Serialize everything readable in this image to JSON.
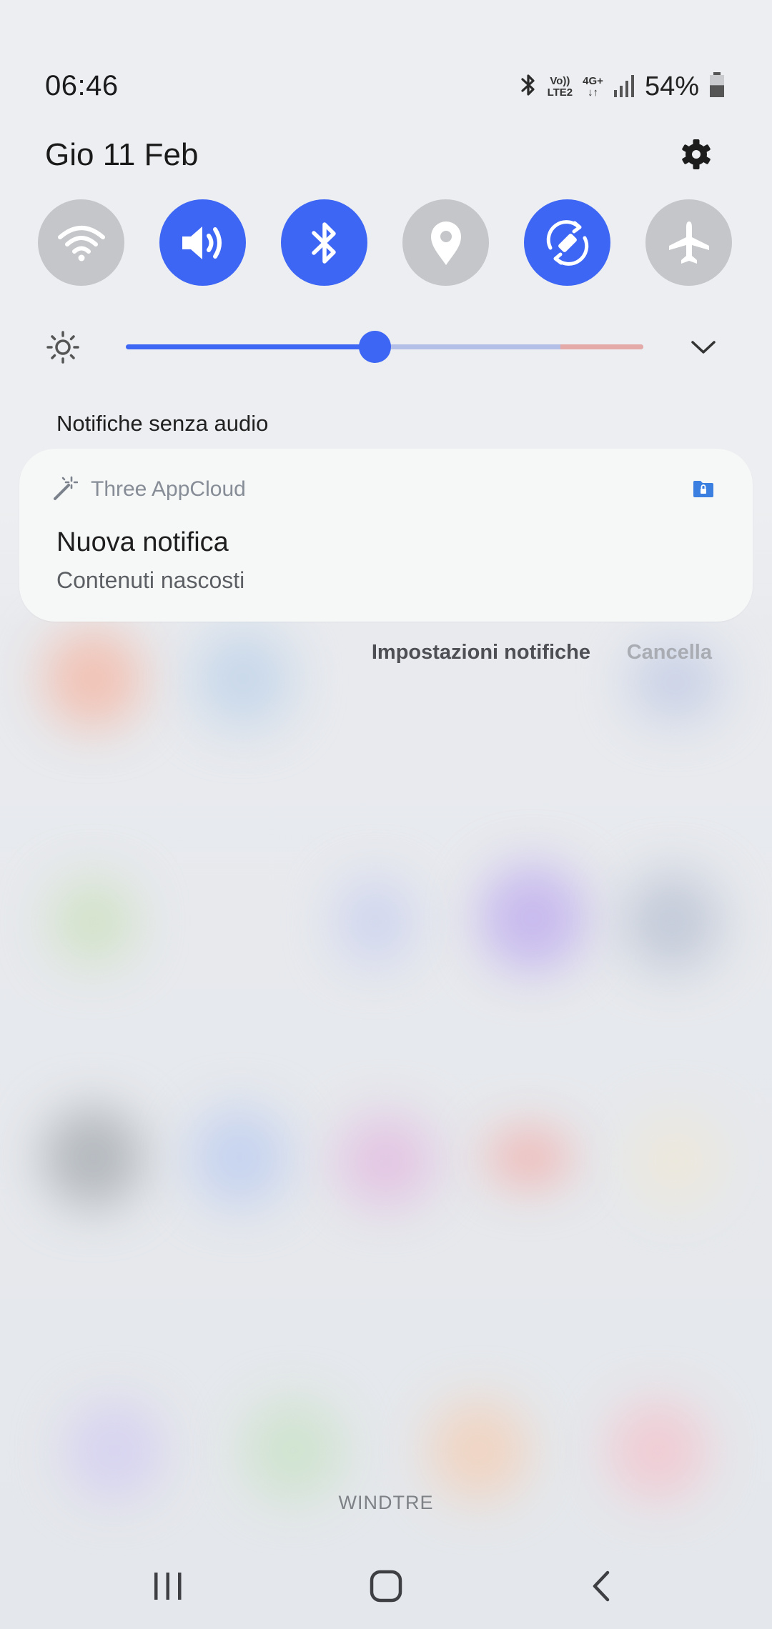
{
  "status_bar": {
    "time": "06:46",
    "network_top": "Vo))",
    "network_bottom": "LTE2",
    "data_top": "4G+",
    "data_bottom": "↓↑",
    "battery_percent": "54%",
    "battery_level": 0.54,
    "icons": [
      "bluetooth-icon",
      "signal-icon",
      "battery-icon"
    ]
  },
  "header": {
    "date": "Gio 11 Feb",
    "settings_icon": "gear-icon"
  },
  "quick_settings": {
    "active_color": "#3e66f4",
    "inactive_color": "#c4c6c9",
    "tiles": [
      {
        "id": "wifi",
        "icon": "wifi-icon",
        "on": false
      },
      {
        "id": "sound",
        "icon": "volume-icon",
        "on": true
      },
      {
        "id": "bluetooth",
        "icon": "bluetooth-icon",
        "on": true
      },
      {
        "id": "location",
        "icon": "location-pin-icon",
        "on": false
      },
      {
        "id": "auto-rotate",
        "icon": "auto-rotate-icon",
        "on": true
      },
      {
        "id": "airplane",
        "icon": "airplane-icon",
        "on": false
      }
    ]
  },
  "brightness": {
    "icon": "brightness-icon",
    "level": 0.48,
    "warning_from": 0.84,
    "expand_icon": "chevron-down-icon"
  },
  "notifications": {
    "section_label": "Notifiche senza audio",
    "items": [
      {
        "app_name": "Three AppCloud",
        "app_icon": "magic-wand-icon",
        "badge_icon": "secure-folder-icon",
        "title": "Nuova notifica",
        "text": "Contenuti nascosti"
      }
    ],
    "settings_label": "Impostazioni notifiche",
    "clear_label": "Cancella"
  },
  "carrier": "WINDTRE",
  "navigation": {
    "recents_icon": "recents-icon",
    "home_icon": "home-icon",
    "back_icon": "back-icon"
  }
}
